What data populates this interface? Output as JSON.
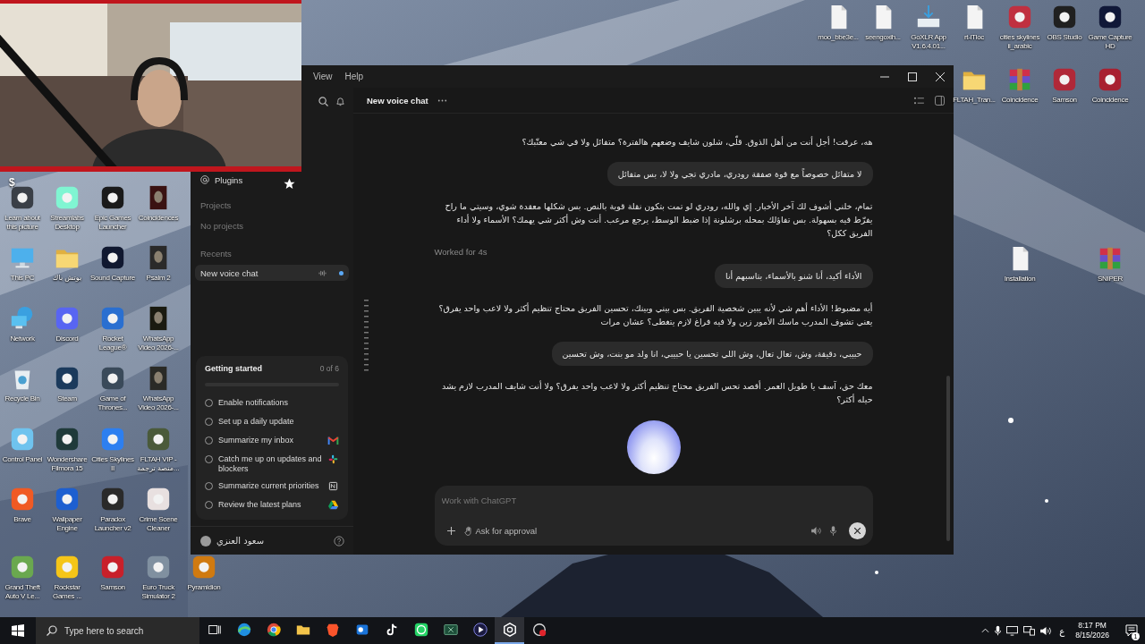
{
  "desktop": {
    "mark": "$",
    "left_rows": [
      [
        {
          "label": "Learn about this picture",
          "kind": "tile",
          "color": "#3a3f47"
        },
        {
          "label": "Streamlabs Desktop",
          "kind": "tile",
          "color": "#80f5d2"
        },
        {
          "label": "Epic Games Launcher",
          "kind": "tile",
          "color": "#1a1a1a"
        },
        {
          "label": "Coincidences",
          "kind": "thumb",
          "color": "#3a1212"
        }
      ],
      [
        {
          "label": "This PC",
          "kind": "monitor"
        },
        {
          "label": "بوتش باك",
          "kind": "folder"
        },
        {
          "label": "Sound Capture",
          "kind": "tile",
          "color": "#101830"
        },
        {
          "label": "Psalm 2",
          "kind": "thumb",
          "color": "#2a2a2a"
        }
      ],
      [
        {
          "label": "Network",
          "kind": "network"
        },
        {
          "label": "Discord",
          "kind": "tile",
          "color": "#5865f2"
        },
        {
          "label": "Rocket League®",
          "kind": "tile",
          "color": "#2a6fd0"
        },
        {
          "label": "WhatsApp Video 2026-...",
          "kind": "thumb",
          "color": "#1a1a10"
        }
      ],
      [
        {
          "label": "Recycle Bin",
          "kind": "bin"
        },
        {
          "label": "Steam",
          "kind": "tile",
          "color": "#1b3a5c"
        },
        {
          "label": "Game of Thrones...",
          "kind": "tile",
          "color": "#3a4a5a"
        },
        {
          "label": "WhatsApp Video 2026-...",
          "kind": "thumb",
          "color": "#2a2a26"
        }
      ],
      [
        {
          "label": "Control Panel",
          "kind": "tile",
          "color": "#6fc3ee"
        },
        {
          "label": "Wondershare Filmora 15",
          "kind": "tile",
          "color": "#1f3a3a"
        },
        {
          "label": "Cities Skylines II",
          "kind": "tile",
          "color": "#2d7ff0"
        },
        {
          "label": "FLTAH VIP - منصة ترجمة...",
          "kind": "tile",
          "color": "#4a5a3a"
        }
      ],
      [
        {
          "label": "Brave",
          "kind": "tile",
          "color": "#f05a24"
        },
        {
          "label": "Wallpaper Engine",
          "kind": "tile",
          "color": "#1d5fd0"
        },
        {
          "label": "Paradox Launcher v2",
          "kind": "tile",
          "color": "#2a2a2a"
        },
        {
          "label": "Crime Scene Cleaner",
          "kind": "tile",
          "color": "#e8e0e0"
        }
      ],
      [
        {
          "label": "Grand Theft Auto V Le...",
          "kind": "tile",
          "color": "#6aa84f"
        },
        {
          "label": "Rockstar Games ...",
          "kind": "tile",
          "color": "#f5c518"
        },
        {
          "label": "Samson",
          "kind": "tile",
          "color": "#c8202a"
        },
        {
          "label": "Euro Truck Simulator 2",
          "kind": "tile",
          "color": "#8090a0"
        },
        {
          "label": "Pyramidion",
          "kind": "tile",
          "color": "#d07a10"
        }
      ]
    ],
    "right_icons": [
      {
        "label": "moo_bbe3e...",
        "kind": "file"
      },
      {
        "label": "seengoxih...",
        "kind": "file"
      },
      {
        "label": "GoXLR App V1.6.4.01...",
        "kind": "installer"
      },
      {
        "label": "rt-iTloc",
        "kind": "file"
      },
      {
        "label": "cities skylines ii_arabic",
        "kind": "tile",
        "color": "#c03040"
      },
      {
        "label": "OBS Studio",
        "kind": "tile",
        "color": "#202020"
      },
      {
        "label": "Game Capture HD",
        "kind": "tile",
        "color": "#101838"
      },
      {
        "label": "FLTAH_Tran...",
        "kind": "folder"
      },
      {
        "label": "Coincidence",
        "kind": "archive"
      },
      {
        "label": "Samson",
        "kind": "tile",
        "color": "#b02838"
      },
      {
        "label": "Coincidence",
        "kind": "tile",
        "color": "#a82030"
      },
      {
        "label": "Installation",
        "kind": "file"
      },
      {
        "label": "SNIPER",
        "kind": "archive"
      }
    ]
  },
  "window": {
    "menu": [
      "View",
      "Help"
    ],
    "sidebar": {
      "plugins": "Plugins",
      "projects": {
        "heading": "Projects",
        "empty": "No projects"
      },
      "recents": {
        "heading": "Recents",
        "items": [
          {
            "label": "New voice chat",
            "selected": true,
            "live": true
          }
        ]
      },
      "getting_started": {
        "title": "Getting started",
        "count": "0 of 6",
        "level": 0,
        "items": [
          {
            "label": "Enable notifications",
            "checked": false
          },
          {
            "label": "Set up a daily update",
            "checked": false
          },
          {
            "label": "Summarize my inbox",
            "checked": false,
            "kind": "mail"
          },
          {
            "label": "Catch me up on updates and blockers",
            "checked": false,
            "kind": "chat"
          },
          {
            "label": "Summarize current priorities",
            "checked": false,
            "kind": "notes"
          },
          {
            "label": "Review the latest plans",
            "checked": false,
            "kind": "drive"
          }
        ]
      },
      "user": "سعود العنزي"
    },
    "header": {
      "title": "New voice chat"
    },
    "messages": [
      {
        "kind": "assistant",
        "text": "هه، عرفت! أجل أنت من أهل الذوق. قلّي، شلون شايف وضعهم هالفترة؟ متفائل ولا في شي معتّبك؟"
      },
      {
        "kind": "user",
        "text": "لا متفائل خصوصاً مع قوة صفقة رودري، مادري تجي ولا لا، بس متفائل"
      },
      {
        "kind": "assistant",
        "text": "تمام، خلني أشوف لك آخر الأخبار. إي والله، رودري لو تمت بتكون نقلة قوية بالنص. بس شكلها معقدة شوي، وسيتي ما راح يفرّط فيه بسهولة. بس تفاؤلك بمحله برشلونة إذا ضبط الوسط، يرجع مرعب. أنت وش أكثر شي يهمك؟ الأسماء ولا أداء الفريق ككل؟"
      },
      {
        "kind": "status",
        "text": "Worked for 4s"
      },
      {
        "kind": "user",
        "text": "الأداء أكيد، أنا شنو بالأسماء، بتاسبهم أنا"
      },
      {
        "kind": "assistant",
        "text": "أيه مضبوط! الأداء أهم شي لأنه يبين شخصية الفريق. بس بيني وبينك، تحسين الفريق محتاج تنظيم أكثر ولا لاعب واحد يفرق؟ يعني تشوف المدرب ماسك الأمور زين ولا فيه فراغ لازم يتغطى؟ عشان مرات"
      },
      {
        "kind": "user",
        "text": "حبيبي، دقيقة، وش، تعال تعال، وش اللي تحسين يا حبيبي، انا ولد مو بنت، وش تحسين"
      },
      {
        "kind": "assistant",
        "text": "معك حق، آسف يا طويل العمر. أقصد تحس الفريق محتاج تنظيم أكثر ولا لاعب واحد يفرق؟ ولا أنت شايف المدرب لازم يشد حيله أكثر؟"
      }
    ],
    "composer": {
      "placeholder": "Work with ChatGPT",
      "approval": "Ask for approval"
    }
  },
  "taskbar": {
    "search_placeholder": "Type here to search",
    "apps": [
      {
        "kind": "taskview",
        "selected": false
      },
      {
        "kind": "edge",
        "selected": false
      },
      {
        "kind": "chrome",
        "selected": false
      },
      {
        "kind": "explorer",
        "selected": false
      },
      {
        "kind": "brave",
        "selected": false
      },
      {
        "kind": "outlook",
        "selected": false
      },
      {
        "kind": "tiktok",
        "selected": false
      },
      {
        "kind": "whatsapp",
        "selected": false
      },
      {
        "kind": "excel",
        "selected": false
      },
      {
        "kind": "video",
        "selected": false
      },
      {
        "kind": "chatgpt",
        "selected": true
      },
      {
        "kind": "recorder",
        "selected": false
      }
    ],
    "language": "ع",
    "time": "8:17 PM",
    "date": "8/15/2026",
    "notifications": "1"
  }
}
